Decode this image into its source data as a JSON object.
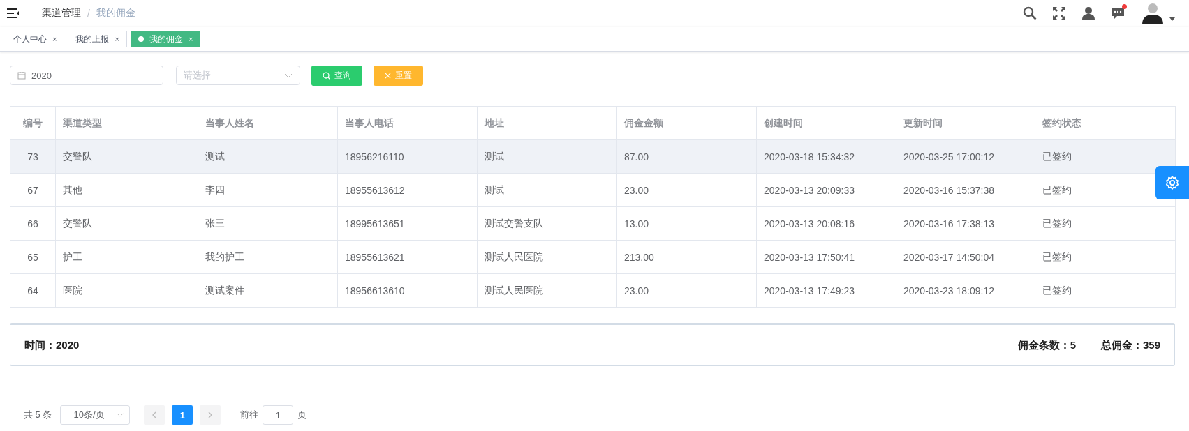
{
  "breadcrumb": [
    "渠道管理",
    "我的佣金"
  ],
  "breadcrumb_separator": "/",
  "header": {
    "notification_dot": true
  },
  "tabs": [
    {
      "label": "个人中心",
      "close": "×",
      "selected": false
    },
    {
      "label": "我的上报",
      "close": "×",
      "selected": false
    },
    {
      "label": "我的佣金",
      "close": "×",
      "selected": true
    }
  ],
  "filters": {
    "year": {
      "value": "2020"
    },
    "select": {
      "placeholder": "请选择"
    },
    "search_button": "查询",
    "reset_button": "重置"
  },
  "table": {
    "columns": [
      "编号",
      "渠道类型",
      "当事人姓名",
      "当事人电话",
      "地址",
      "佣金金额",
      "创建时间",
      "更新时间",
      "签约状态"
    ],
    "rows": [
      {
        "selected": true,
        "cells": [
          "73",
          "交警队",
          "测试",
          "18956216110",
          "测试",
          "87.00",
          "2020-03-18 15:34:32",
          "2020-03-25 17:00:12",
          "已签约"
        ]
      },
      {
        "selected": false,
        "cells": [
          "67",
          "其他",
          "李四",
          "18955613612",
          "测试",
          "23.00",
          "2020-03-13 20:09:33",
          "2020-03-16 15:37:38",
          "已签约"
        ]
      },
      {
        "selected": false,
        "cells": [
          "66",
          "交警队",
          "张三",
          "18995613651",
          "测试交警支队",
          "13.00",
          "2020-03-13 20:08:16",
          "2020-03-16 17:38:13",
          "已签约"
        ]
      },
      {
        "selected": false,
        "cells": [
          "65",
          "护工",
          "我的护工",
          "18955613621",
          "测试人民医院",
          "213.00",
          "2020-03-13 17:50:41",
          "2020-03-17 14:50:04",
          "已签约"
        ]
      },
      {
        "selected": false,
        "cells": [
          "64",
          "医院",
          "测试案件",
          "18956613610",
          "测试人民医院",
          "23.00",
          "2020-03-13 17:49:23",
          "2020-03-23 18:09:12",
          "已签约"
        ]
      }
    ]
  },
  "summary": {
    "time": "时间：2020",
    "count": "佣金条数：5",
    "total": "总佣金：359"
  },
  "pagination": {
    "total": "共 5 条",
    "page_size": "10条/页",
    "pages": [
      {
        "label": "1",
        "selected": true
      }
    ],
    "goto_label": "前往",
    "goto_value": "1",
    "page_unit": "页"
  }
}
